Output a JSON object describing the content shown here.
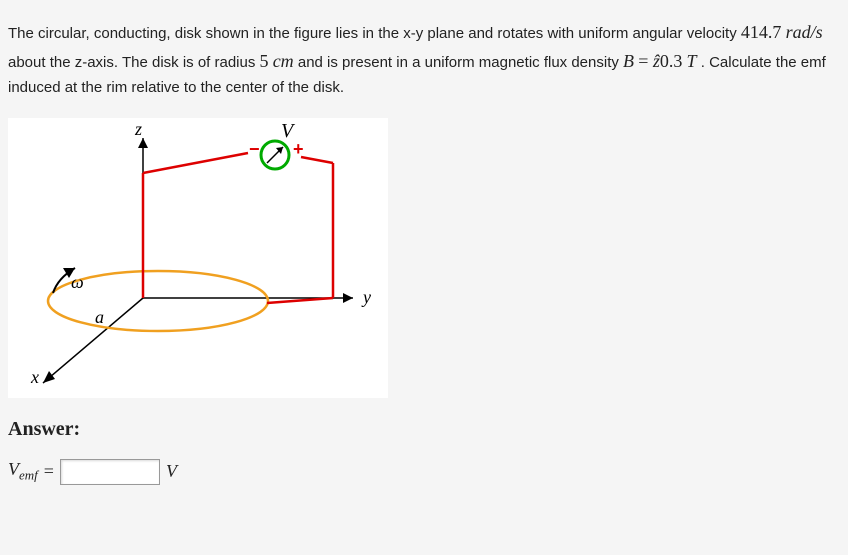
{
  "problem": {
    "text1": "The circular, conducting, disk shown in the figure lies in the x-y plane and rotates with uniform angular velocity ",
    "angular_velocity": "414.7",
    "angular_velocity_unit": "rad/s",
    "text2": " about the z-axis. The disk is of radius ",
    "radius": "5",
    "radius_unit": "cm",
    "text3": " and is present in a uniform magnetic flux density ",
    "B_var": "B",
    "equals": " = ",
    "z_hat": "ẑ",
    "flux_density": "0.3",
    "flux_unit": "T",
    "text4": ". Calculate the emf induced at the rim relative to the center of the disk."
  },
  "figure": {
    "labels": {
      "z": "z",
      "y": "y",
      "x": "x",
      "V": "V",
      "omega": "ω",
      "a": "a",
      "minus": "−",
      "plus": "+"
    }
  },
  "answer": {
    "label": "Answer:",
    "var": "V",
    "sub": "emf",
    "equals": "=",
    "unit": "V",
    "value": ""
  }
}
